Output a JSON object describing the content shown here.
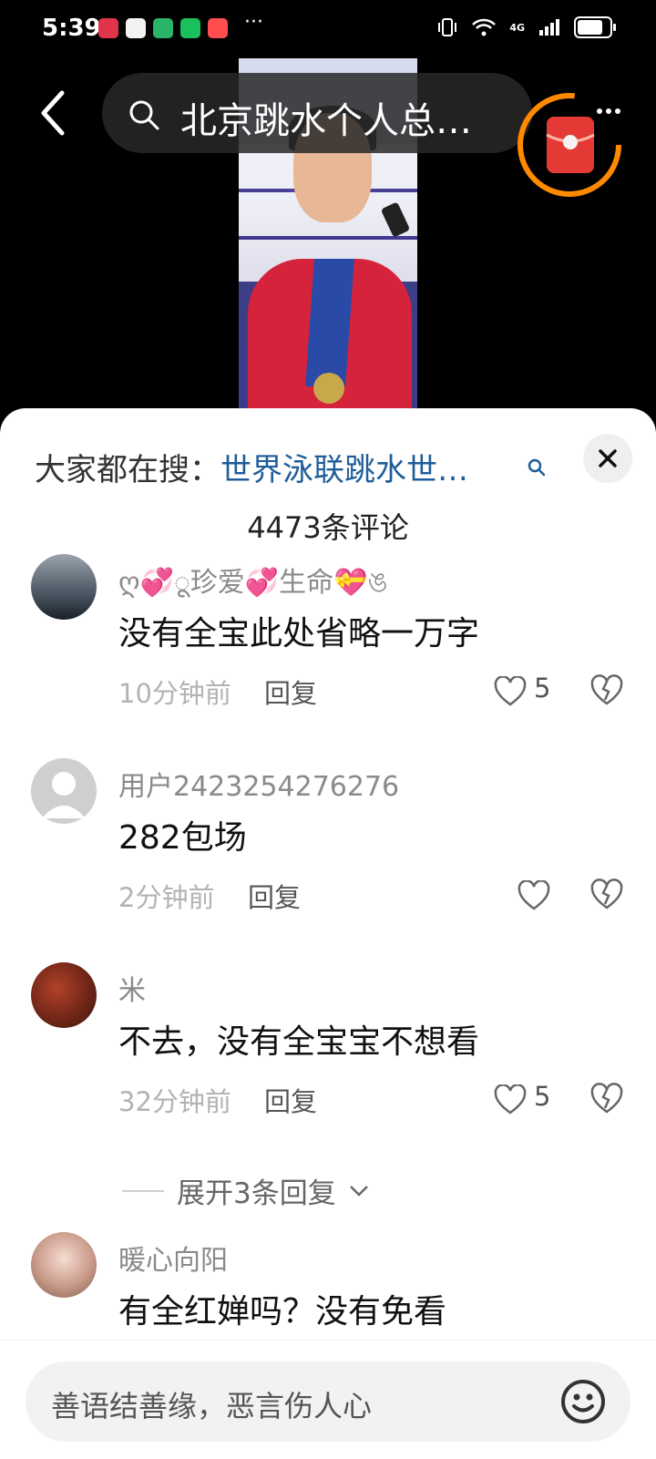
{
  "status_bar": {
    "time": "5:39",
    "dots": "···",
    "network": "4G"
  },
  "header": {
    "search_text": "北京跳水个人总…"
  },
  "sheet": {
    "trending_label": "大家都在搜：",
    "trending_term": "世界泳联跳水世…",
    "comment_count": "4473条评论"
  },
  "comments": [
    {
      "user": "ღ💞ू珍爱💞生命💝ঙ",
      "text": "没有全宝此处省略一万字",
      "time": "10分钟前",
      "reply": "回复",
      "likes": "5"
    },
    {
      "user": "用户2423254276276",
      "text": "282包场",
      "time": "2分钟前",
      "reply": "回复",
      "likes": ""
    },
    {
      "user": "米",
      "text": "不去，没有全宝宝不想看",
      "time": "32分钟前",
      "reply": "回复",
      "likes": "5"
    },
    {
      "user": "暖心向阳",
      "text": "有全红婵吗？没有免看"
    }
  ],
  "expand_replies": "展开3条回复",
  "input": {
    "placeholder": "善语结善缘，恶言伤人心"
  },
  "colors": {
    "link": "#1f5d99",
    "accent": "#e53935",
    "ring": "#ff8a00"
  },
  "icons": [
    "back-arrow-icon",
    "search-icon",
    "red-packet-icon",
    "close-icon",
    "heart-icon",
    "broken-heart-icon",
    "chevron-down-icon",
    "emoji-icon"
  ]
}
